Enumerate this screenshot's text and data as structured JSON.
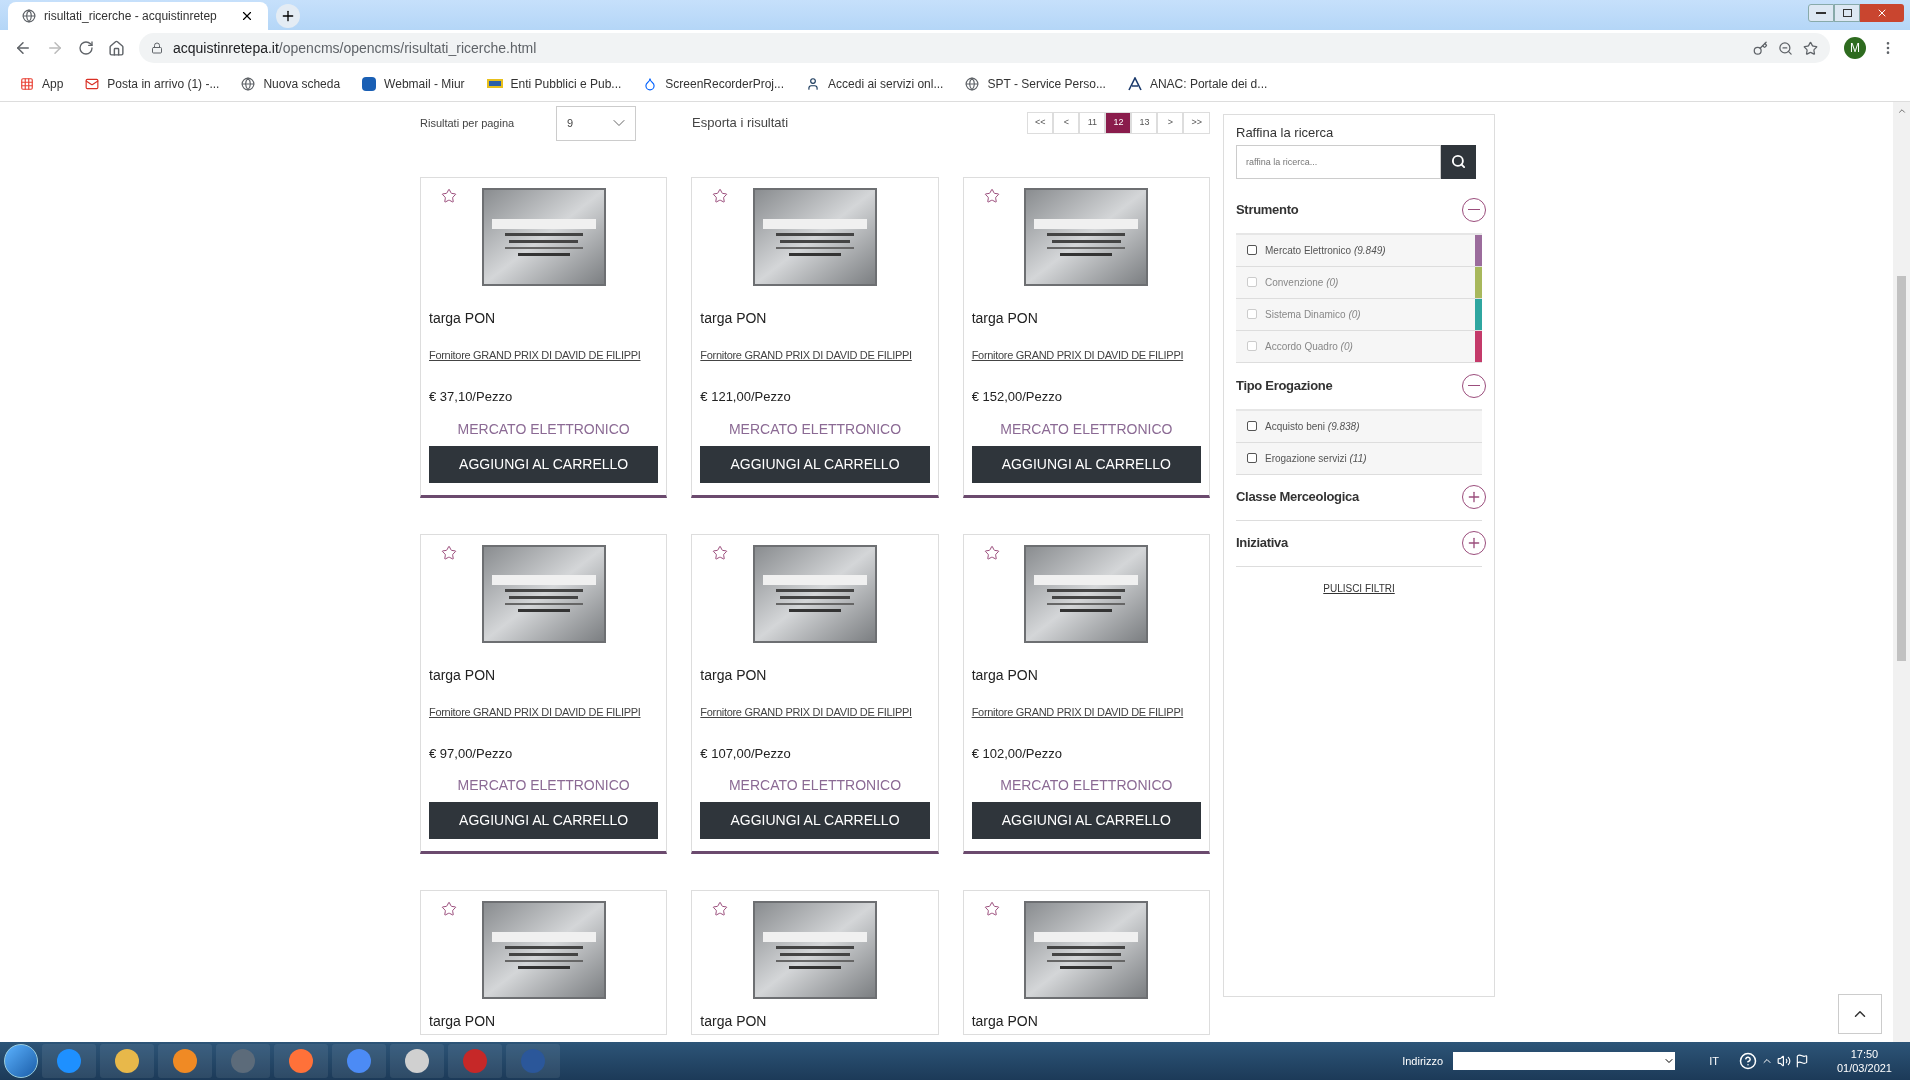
{
  "browser": {
    "tab_title": "risultati_ricerche - acquistinretep",
    "url_domain": "acquistinretepa.it",
    "url_path": "/opencms/opencms/risultati_ricerche.html",
    "profile_initial": "M",
    "bookmarks": [
      {
        "kind": "apps",
        "label": "App"
      },
      {
        "kind": "mail",
        "label": "Posta in arrivo (1) -..."
      },
      {
        "kind": "globe",
        "label": "Nuova scheda"
      },
      {
        "kind": "badge",
        "label": "Webmail - Miur"
      },
      {
        "kind": "flag",
        "label": "Enti Pubblici e Pub..."
      },
      {
        "kind": "dropbox",
        "label": "ScreenRecorderProj..."
      },
      {
        "kind": "person",
        "label": "Accedi ai servizi onl..."
      },
      {
        "kind": "globe",
        "label": "SPT - Service Perso..."
      },
      {
        "kind": "letter",
        "label": "ANAC: Portale dei d..."
      }
    ]
  },
  "toolbar": {
    "per_page_label": "Risultati per pagina",
    "per_page_value": "9",
    "export_label": "Esporta i risultati",
    "pagination": [
      {
        "label": "<<",
        "selected": false
      },
      {
        "label": "<",
        "selected": false
      },
      {
        "label": "11",
        "selected": false
      },
      {
        "label": "12",
        "selected": true
      },
      {
        "label": "13",
        "selected": false
      },
      {
        "label": ">",
        "selected": false
      },
      {
        "label": ">>",
        "selected": false
      }
    ]
  },
  "products": [
    {
      "title": "targa PON",
      "supplier": "Fornitore GRAND PRIX DI DAVID DE FILIPPI",
      "price": "€ 37,10/Pezzo",
      "channel": "MERCATO ELETTRONICO",
      "button": "AGGIUNGI AL CARRELLO"
    },
    {
      "title": "targa PON",
      "supplier": "Fornitore GRAND PRIX DI DAVID DE FILIPPI",
      "price": "€ 121,00/Pezzo",
      "channel": "MERCATO ELETTRONICO",
      "button": "AGGIUNGI AL CARRELLO"
    },
    {
      "title": "targa PON",
      "supplier": "Fornitore GRAND PRIX DI DAVID DE FILIPPI",
      "price": "€ 152,00/Pezzo",
      "channel": "MERCATO ELETTRONICO",
      "button": "AGGIUNGI AL CARRELLO"
    },
    {
      "title": "targa PON",
      "supplier": "Fornitore GRAND PRIX DI DAVID DE FILIPPI",
      "price": "€ 97,00/Pezzo",
      "channel": "MERCATO ELETTRONICO",
      "button": "AGGIUNGI AL CARRELLO"
    },
    {
      "title": "targa PON",
      "supplier": "Fornitore GRAND PRIX DI DAVID DE FILIPPI",
      "price": "€ 107,00/Pezzo",
      "channel": "MERCATO ELETTRONICO",
      "button": "AGGIUNGI AL CARRELLO"
    },
    {
      "title": "targa PON",
      "supplier": "Fornitore GRAND PRIX DI DAVID DE FILIPPI",
      "price": "€ 102,00/Pezzo",
      "channel": "MERCATO ELETTRONICO",
      "button": "AGGIUNGI AL CARRELLO"
    },
    {
      "title": "targa PON"
    },
    {
      "title": "targa PON"
    },
    {
      "title": "targa PON"
    }
  ],
  "filters": {
    "title": "Raffina la ricerca",
    "search_placeholder": "raffina la ricerca...",
    "clear_label": "PULISCI FILTRI",
    "sections": [
      {
        "title": "Strumento",
        "expanded": true,
        "options": [
          {
            "label": "Mercato Elettronico",
            "count": "(9.849)",
            "checked": false,
            "disabled": false,
            "color": "#9b6c9c"
          },
          {
            "label": "Convenzione",
            "count": "(0)",
            "checked": false,
            "disabled": true,
            "color": "#a8b85c"
          },
          {
            "label": "Sistema Dinamico",
            "count": "(0)",
            "checked": false,
            "disabled": true,
            "color": "#2fa6a0"
          },
          {
            "label": "Accordo Quadro",
            "count": "(0)",
            "checked": false,
            "disabled": true,
            "color": "#c43a6a"
          }
        ]
      },
      {
        "title": "Tipo Erogazione",
        "expanded": true,
        "options": [
          {
            "label": "Acquisto beni",
            "count": "(9.838)",
            "checked": false,
            "disabled": false
          },
          {
            "label": "Erogazione servizi",
            "count": "(11)",
            "checked": false,
            "disabled": false
          }
        ]
      },
      {
        "title": "Classe Merceologica",
        "expanded": false
      },
      {
        "title": "Iniziativa",
        "expanded": false
      }
    ]
  },
  "taskbar": {
    "address_label": "Indirizzo",
    "language": "IT",
    "time": "17:50",
    "date": "01/03/2021"
  }
}
